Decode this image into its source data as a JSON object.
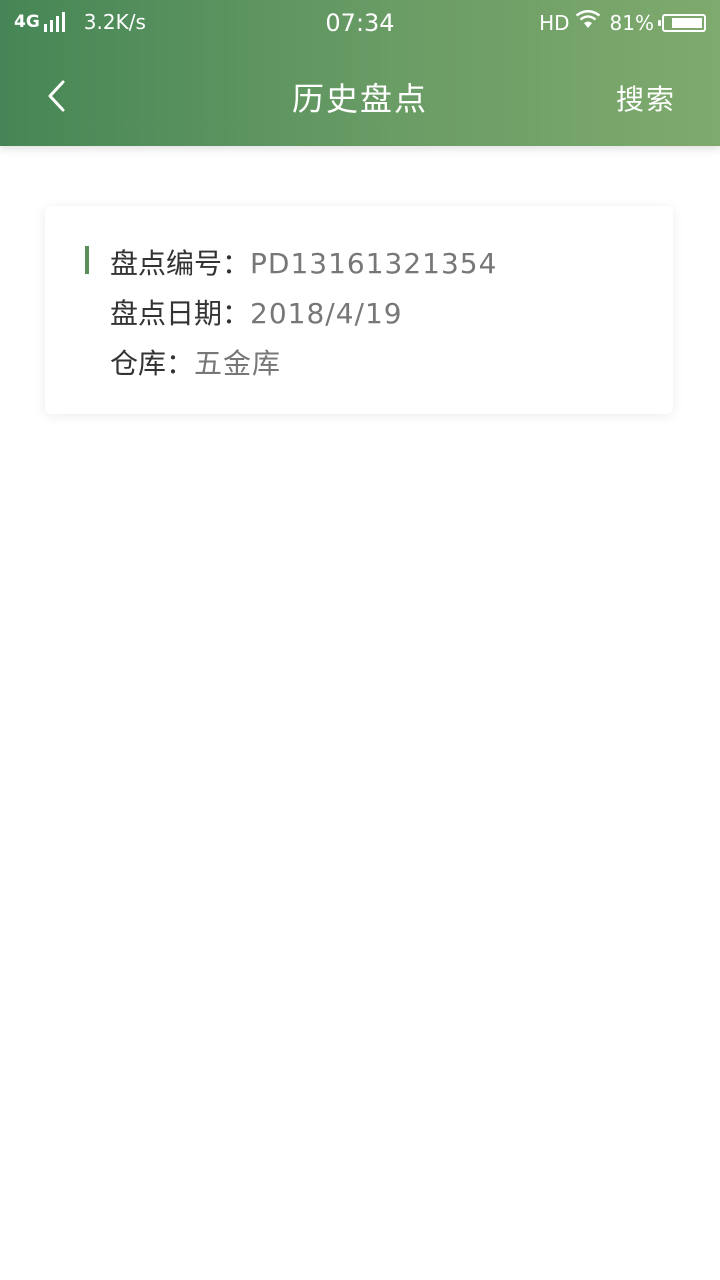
{
  "status_bar": {
    "network": "4G",
    "speed": "3.2K/s",
    "time": "07:34",
    "hd": "HD",
    "battery": "81%"
  },
  "header": {
    "title": "历史盘点",
    "search_label": "搜索",
    "back_icon": "chevron-left-icon",
    "bg_start": "#468656",
    "bg_end": "#7faa6d"
  },
  "record": {
    "number_label": "盘点编号：",
    "number_value": "PD13161321354",
    "date_label": "盘点日期：",
    "date_value": "2018/4/19",
    "warehouse_label": "仓库：",
    "warehouse_value": "五金库",
    "accent_color": "#5a8f5c"
  }
}
